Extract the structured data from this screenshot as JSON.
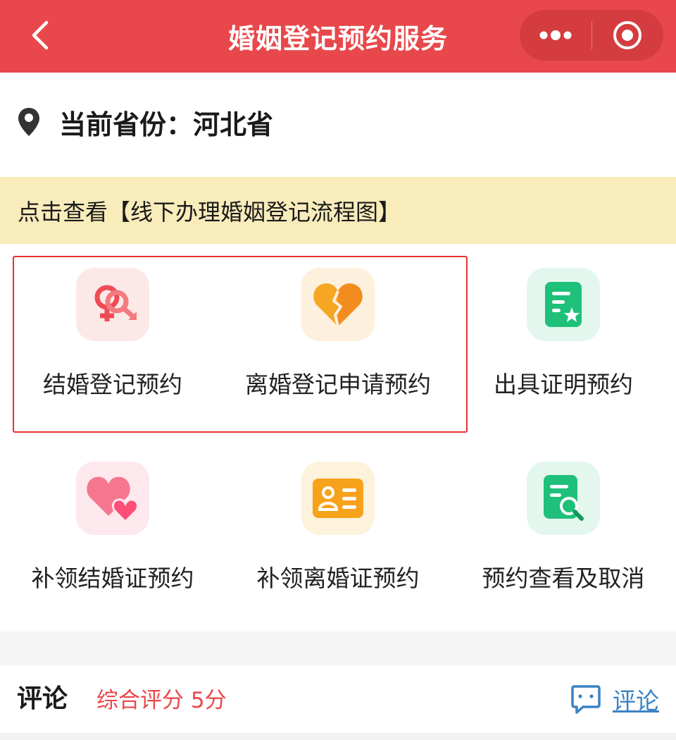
{
  "header": {
    "title": "婚姻登记预约服务",
    "back_icon": "chevron-left-icon",
    "more_icon": "more-dots-icon",
    "close_icon": "target-close-icon",
    "bg_color": "#e8484b"
  },
  "province": {
    "label": "当前省份：河北省",
    "icon": "location-pin-icon"
  },
  "banner": {
    "text": "点击查看【线下办理婚姻登记流程图】",
    "bg_color": "#f9ecbb"
  },
  "services": [
    {
      "label": "结婚登记预约",
      "icon": "gender-rings-icon",
      "bg": "#fde8e8"
    },
    {
      "label": "离婚登记申请预约",
      "icon": "broken-heart-icon",
      "bg": "#fdf0dc"
    },
    {
      "label": "出具证明预约",
      "icon": "certificate-star-icon",
      "bg": "#e3f7ee"
    },
    {
      "label": "补领结婚证预约",
      "icon": "double-heart-icon",
      "bg": "#fde8ee"
    },
    {
      "label": "补领离婚证预约",
      "icon": "id-card-icon",
      "bg": "#fdf2dc"
    },
    {
      "label": "预约查看及取消",
      "icon": "document-search-icon",
      "bg": "#e3f7ee"
    }
  ],
  "comments": {
    "title": "评论",
    "score": "综合评分 5分",
    "link_label": "评论",
    "link_icon": "chat-bubble-icon"
  },
  "colors": {
    "accent": "#e8484b",
    "highlight_border": "#e6332f",
    "link": "#3b82c4"
  }
}
